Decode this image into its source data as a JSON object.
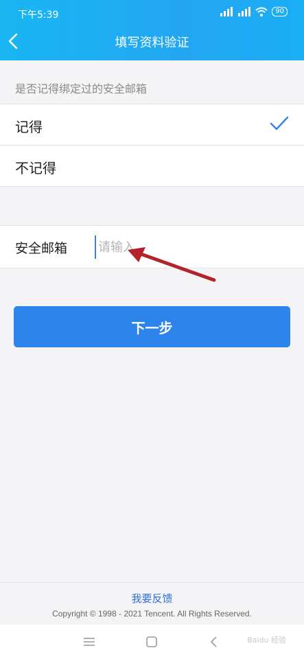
{
  "status_bar": {
    "time": "下午5:39",
    "network_1": "4G",
    "network_2": "HD",
    "battery": "90"
  },
  "nav": {
    "title": "填写资料验证"
  },
  "question": {
    "label": "是否记得绑定过的安全邮箱"
  },
  "options": [
    {
      "label": "记得",
      "selected": true
    },
    {
      "label": "不记得",
      "selected": false
    }
  ],
  "email": {
    "label": "安全邮箱",
    "value": "",
    "placeholder": "请输入"
  },
  "next_button": {
    "label": "下一步"
  },
  "footer": {
    "feedback": "我要反馈",
    "copyright": "Copyright © 1998 - 2021 Tencent. All Rights Reserved."
  },
  "watermark": "Baidu 经验",
  "colors": {
    "header_start": "#19b6f3",
    "header_end": "#23a6f2",
    "button": "#2d84ea",
    "check": "#2d84ea",
    "annotation_arrow": "#b3232a",
    "link": "#2d6fd6"
  },
  "icons": {
    "back": "chevron-left-icon",
    "check": "check-icon",
    "annotation": "red-arrow-icon"
  }
}
